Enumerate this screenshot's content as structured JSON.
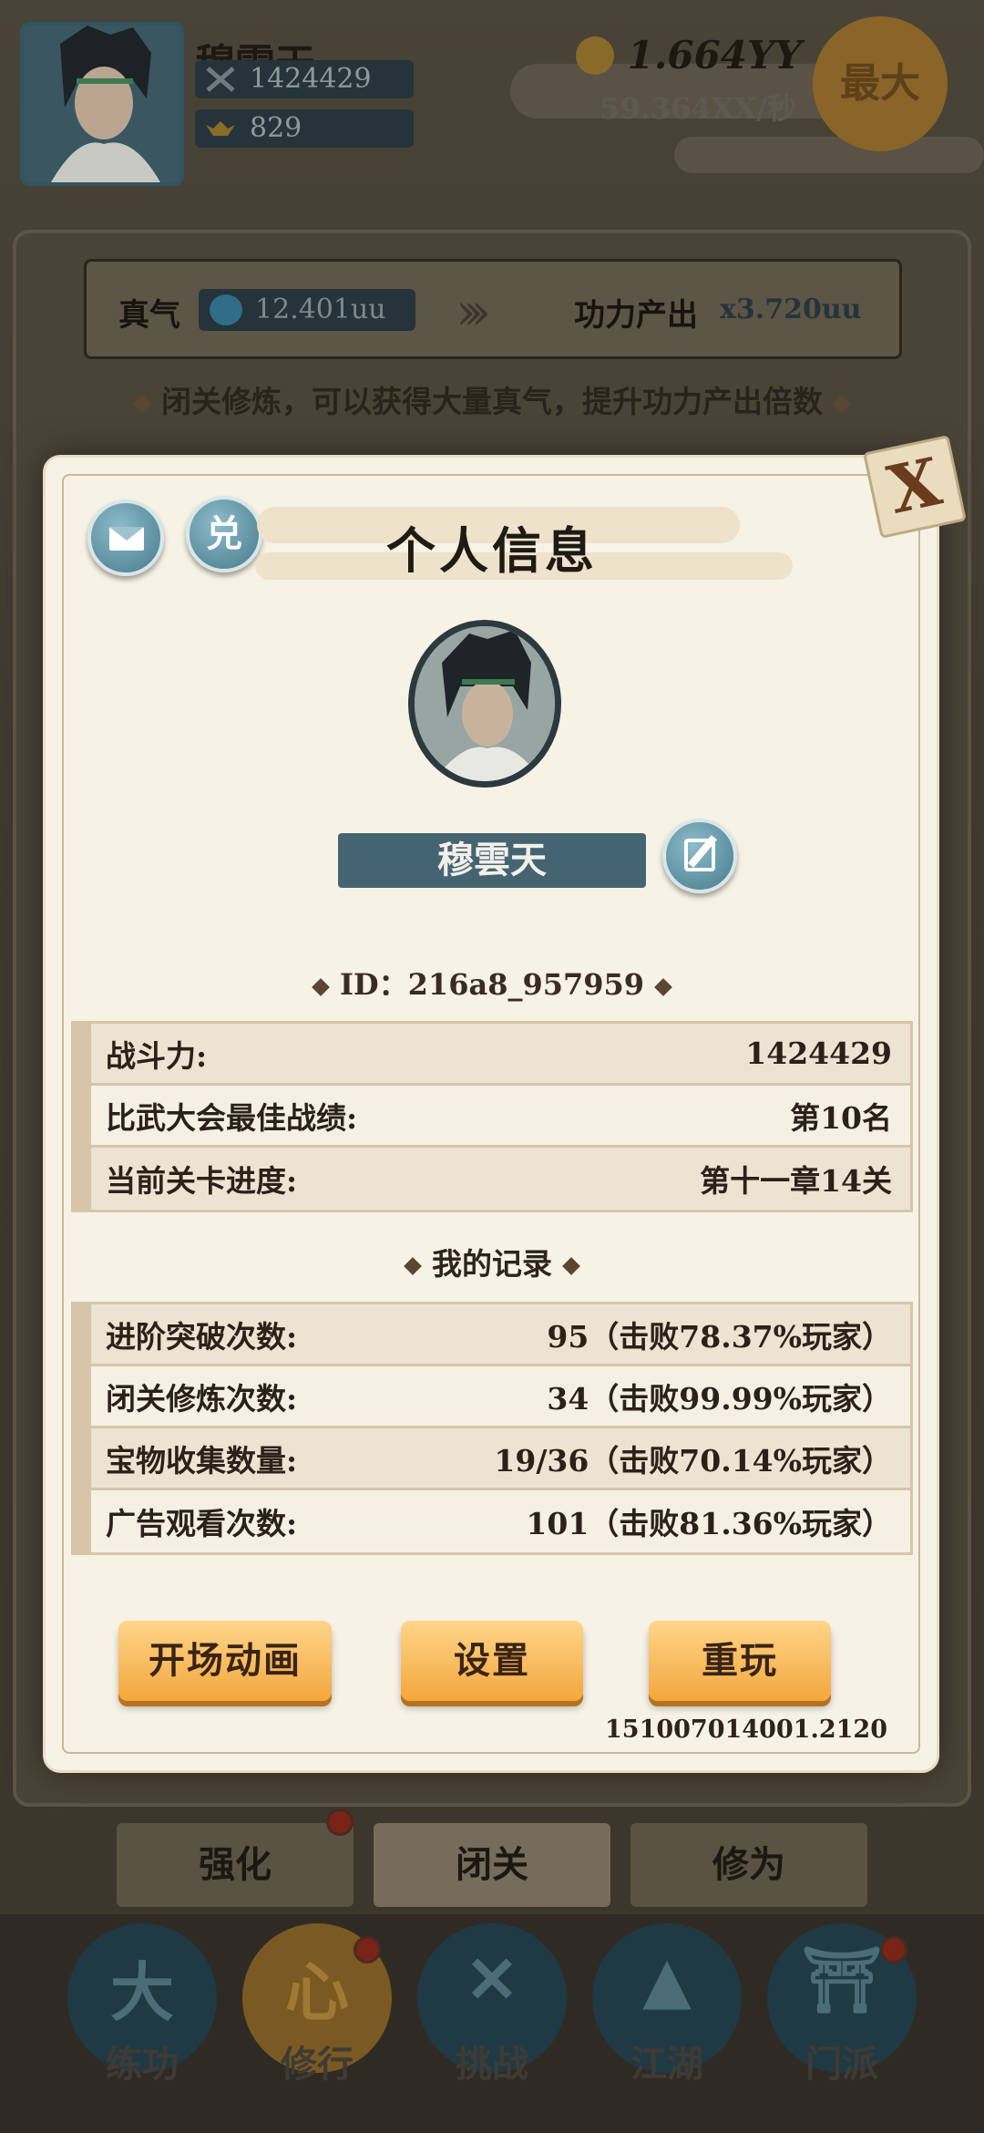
{
  "header": {
    "player_name": "穆雲天",
    "combat_power": "1424429",
    "ingots": "829",
    "gold_amount": "1.664YY",
    "gold_rate": "59.364XX/秒",
    "max_button": "最大"
  },
  "cultivation": {
    "qi_label": "真气",
    "qi_value": "12.401uu",
    "power_output_label": "功力产出",
    "power_output_value": "x3.720uu",
    "tip": "闭关修炼，可以获得大量真气，提升功力产出倍数"
  },
  "modal": {
    "title": "个人信息",
    "redeem_button": "兑",
    "close_button": "X",
    "name": "穆雲天",
    "id_line": "ID：216a8_957959",
    "stats": [
      {
        "label": "战斗力:",
        "value": "1424429"
      },
      {
        "label": "比武大会最佳战绩:",
        "value": "第10名"
      },
      {
        "label": "当前关卡进度:",
        "value": "第十一章14关"
      }
    ],
    "records_title": "我的记录",
    "records": [
      {
        "label": "进阶突破次数:",
        "value": "95（击败78.37%玩家）"
      },
      {
        "label": "闭关修炼次数:",
        "value": "34（击败99.99%玩家）"
      },
      {
        "label": "宝物收集数量:",
        "value": "19/36（击败70.14%玩家）"
      },
      {
        "label": "广告观看次数:",
        "value": "101（击败81.36%玩家）"
      }
    ],
    "buttons": {
      "intro": "开场动画",
      "settings": "设置",
      "replay": "重玩"
    },
    "version": "151007014001.2120"
  },
  "sub_tabs": [
    "强化",
    "闭关",
    "修为"
  ],
  "bottom_nav": [
    {
      "label": "练功",
      "icon": "training-icon"
    },
    {
      "label": "修行",
      "icon": "heart-cultivation-icon"
    },
    {
      "label": "挑战",
      "icon": "crossed-swords-icon"
    },
    {
      "label": "江湖",
      "icon": "mountain-icon"
    },
    {
      "label": "门派",
      "icon": "sect-gate-icon"
    }
  ],
  "colors": {
    "panel_bg": "#f7f2e6",
    "button_orange": "#f3a73d",
    "teal_button": "#477a8c",
    "name_box": "#456472"
  }
}
